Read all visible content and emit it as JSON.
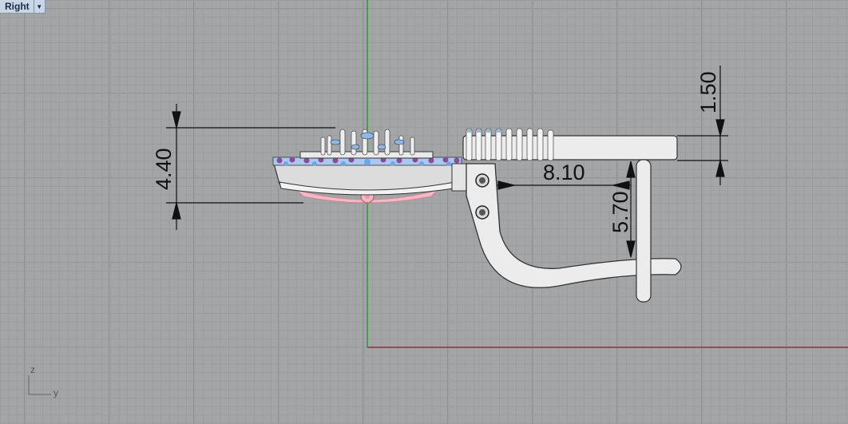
{
  "viewport": {
    "name": "Right",
    "menu_icon": "dropdown-arrow-icon"
  },
  "dimensions": {
    "overall_height": "4.40",
    "top_offset": "1.50",
    "horizontal": "8.10",
    "vertical": "5.70"
  },
  "axes": {
    "vertical_label": "z",
    "horizontal_label": "y"
  },
  "colors": {
    "x_axis": "#b0262c",
    "y_axis": "#23a02a",
    "model_body": "#e8e8e8",
    "gem_blue": "#8fb8ea",
    "gem_purple": "#8a4c98",
    "gem_pink": "#f3b8c4"
  }
}
